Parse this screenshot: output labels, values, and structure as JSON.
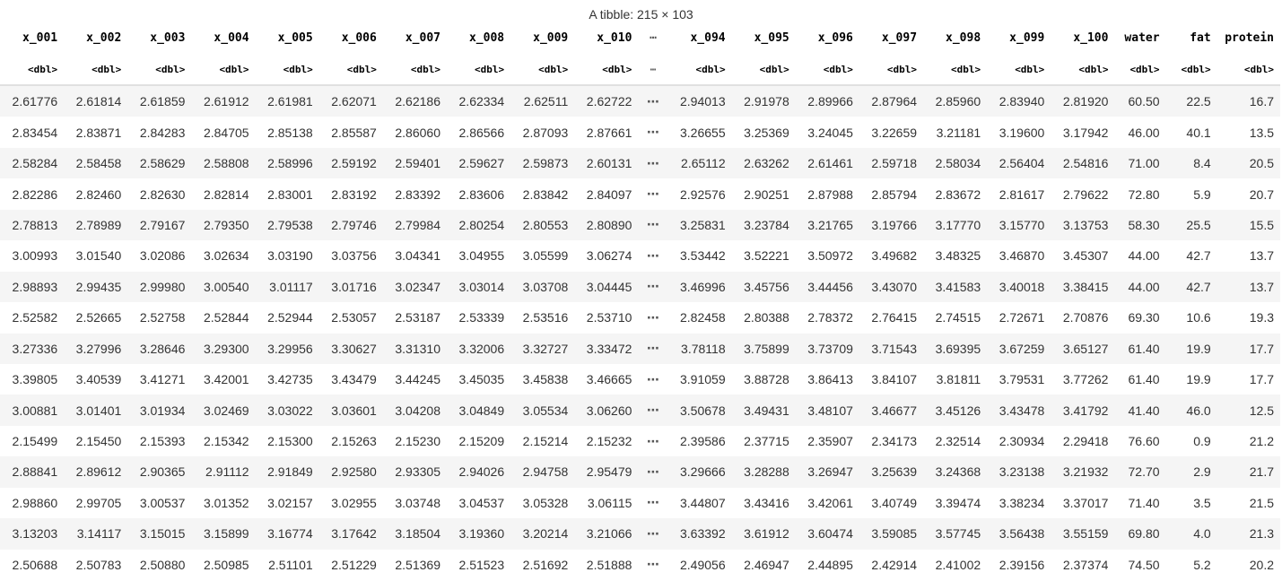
{
  "caption": "A tibble: 215 × 103",
  "columns": [
    "x_001",
    "x_002",
    "x_003",
    "x_004",
    "x_005",
    "x_006",
    "x_007",
    "x_008",
    "x_009",
    "x_010",
    "⋯",
    "x_094",
    "x_095",
    "x_096",
    "x_097",
    "x_098",
    "x_099",
    "x_100",
    "water",
    "fat",
    "protein"
  ],
  "types": [
    "<dbl>",
    "<dbl>",
    "<dbl>",
    "<dbl>",
    "<dbl>",
    "<dbl>",
    "<dbl>",
    "<dbl>",
    "<dbl>",
    "<dbl>",
    "⋯",
    "<dbl>",
    "<dbl>",
    "<dbl>",
    "<dbl>",
    "<dbl>",
    "<dbl>",
    "<dbl>",
    "<dbl>",
    "<dbl>",
    "<dbl>"
  ],
  "rows": [
    [
      "2.61776",
      "2.61814",
      "2.61859",
      "2.61912",
      "2.61981",
      "2.62071",
      "2.62186",
      "2.62334",
      "2.62511",
      "2.62722",
      "⋯",
      "2.94013",
      "2.91978",
      "2.89966",
      "2.87964",
      "2.85960",
      "2.83940",
      "2.81920",
      "60.50",
      "22.5",
      "16.7"
    ],
    [
      "2.83454",
      "2.83871",
      "2.84283",
      "2.84705",
      "2.85138",
      "2.85587",
      "2.86060",
      "2.86566",
      "2.87093",
      "2.87661",
      "⋯",
      "3.26655",
      "3.25369",
      "3.24045",
      "3.22659",
      "3.21181",
      "3.19600",
      "3.17942",
      "46.00",
      "40.1",
      "13.5"
    ],
    [
      "2.58284",
      "2.58458",
      "2.58629",
      "2.58808",
      "2.58996",
      "2.59192",
      "2.59401",
      "2.59627",
      "2.59873",
      "2.60131",
      "⋯",
      "2.65112",
      "2.63262",
      "2.61461",
      "2.59718",
      "2.58034",
      "2.56404",
      "2.54816",
      "71.00",
      "8.4",
      "20.5"
    ],
    [
      "2.82286",
      "2.82460",
      "2.82630",
      "2.82814",
      "2.83001",
      "2.83192",
      "2.83392",
      "2.83606",
      "2.83842",
      "2.84097",
      "⋯",
      "2.92576",
      "2.90251",
      "2.87988",
      "2.85794",
      "2.83672",
      "2.81617",
      "2.79622",
      "72.80",
      "5.9",
      "20.7"
    ],
    [
      "2.78813",
      "2.78989",
      "2.79167",
      "2.79350",
      "2.79538",
      "2.79746",
      "2.79984",
      "2.80254",
      "2.80553",
      "2.80890",
      "⋯",
      "3.25831",
      "3.23784",
      "3.21765",
      "3.19766",
      "3.17770",
      "3.15770",
      "3.13753",
      "58.30",
      "25.5",
      "15.5"
    ],
    [
      "3.00993",
      "3.01540",
      "3.02086",
      "3.02634",
      "3.03190",
      "3.03756",
      "3.04341",
      "3.04955",
      "3.05599",
      "3.06274",
      "⋯",
      "3.53442",
      "3.52221",
      "3.50972",
      "3.49682",
      "3.48325",
      "3.46870",
      "3.45307",
      "44.00",
      "42.7",
      "13.7"
    ],
    [
      "2.98893",
      "2.99435",
      "2.99980",
      "3.00540",
      "3.01117",
      "3.01716",
      "3.02347",
      "3.03014",
      "3.03708",
      "3.04445",
      "⋯",
      "3.46996",
      "3.45756",
      "3.44456",
      "3.43070",
      "3.41583",
      "3.40018",
      "3.38415",
      "44.00",
      "42.7",
      "13.7"
    ],
    [
      "2.52582",
      "2.52665",
      "2.52758",
      "2.52844",
      "2.52944",
      "2.53057",
      "2.53187",
      "2.53339",
      "2.53516",
      "2.53710",
      "⋯",
      "2.82458",
      "2.80388",
      "2.78372",
      "2.76415",
      "2.74515",
      "2.72671",
      "2.70876",
      "69.30",
      "10.6",
      "19.3"
    ],
    [
      "3.27336",
      "3.27996",
      "3.28646",
      "3.29300",
      "3.29956",
      "3.30627",
      "3.31310",
      "3.32006",
      "3.32727",
      "3.33472",
      "⋯",
      "3.78118",
      "3.75899",
      "3.73709",
      "3.71543",
      "3.69395",
      "3.67259",
      "3.65127",
      "61.40",
      "19.9",
      "17.7"
    ],
    [
      "3.39805",
      "3.40539",
      "3.41271",
      "3.42001",
      "3.42735",
      "3.43479",
      "3.44245",
      "3.45035",
      "3.45838",
      "3.46665",
      "⋯",
      "3.91059",
      "3.88728",
      "3.86413",
      "3.84107",
      "3.81811",
      "3.79531",
      "3.77262",
      "61.40",
      "19.9",
      "17.7"
    ],
    [
      "3.00881",
      "3.01401",
      "3.01934",
      "3.02469",
      "3.03022",
      "3.03601",
      "3.04208",
      "3.04849",
      "3.05534",
      "3.06260",
      "⋯",
      "3.50678",
      "3.49431",
      "3.48107",
      "3.46677",
      "3.45126",
      "3.43478",
      "3.41792",
      "41.40",
      "46.0",
      "12.5"
    ],
    [
      "2.15499",
      "2.15450",
      "2.15393",
      "2.15342",
      "2.15300",
      "2.15263",
      "2.15230",
      "2.15209",
      "2.15214",
      "2.15232",
      "⋯",
      "2.39586",
      "2.37715",
      "2.35907",
      "2.34173",
      "2.32514",
      "2.30934",
      "2.29418",
      "76.60",
      "0.9",
      "21.2"
    ],
    [
      "2.88841",
      "2.89612",
      "2.90365",
      "2.91112",
      "2.91849",
      "2.92580",
      "2.93305",
      "2.94026",
      "2.94758",
      "2.95479",
      "⋯",
      "3.29666",
      "3.28288",
      "3.26947",
      "3.25639",
      "3.24368",
      "3.23138",
      "3.21932",
      "72.70",
      "2.9",
      "21.7"
    ],
    [
      "2.98860",
      "2.99705",
      "3.00537",
      "3.01352",
      "3.02157",
      "3.02955",
      "3.03748",
      "3.04537",
      "3.05328",
      "3.06115",
      "⋯",
      "3.44807",
      "3.43416",
      "3.42061",
      "3.40749",
      "3.39474",
      "3.38234",
      "3.37017",
      "71.40",
      "3.5",
      "21.5"
    ],
    [
      "3.13203",
      "3.14117",
      "3.15015",
      "3.15899",
      "3.16774",
      "3.17642",
      "3.18504",
      "3.19360",
      "3.20214",
      "3.21066",
      "⋯",
      "3.63392",
      "3.61912",
      "3.60474",
      "3.59085",
      "3.57745",
      "3.56438",
      "3.55159",
      "69.80",
      "4.0",
      "21.3"
    ],
    [
      "2.50688",
      "2.50783",
      "2.50880",
      "2.50985",
      "2.51101",
      "2.51229",
      "2.51369",
      "2.51523",
      "2.51692",
      "2.51888",
      "⋯",
      "2.49056",
      "2.46947",
      "2.44895",
      "2.42914",
      "2.41002",
      "2.39156",
      "2.37374",
      "74.50",
      "5.2",
      "20.2"
    ]
  ]
}
